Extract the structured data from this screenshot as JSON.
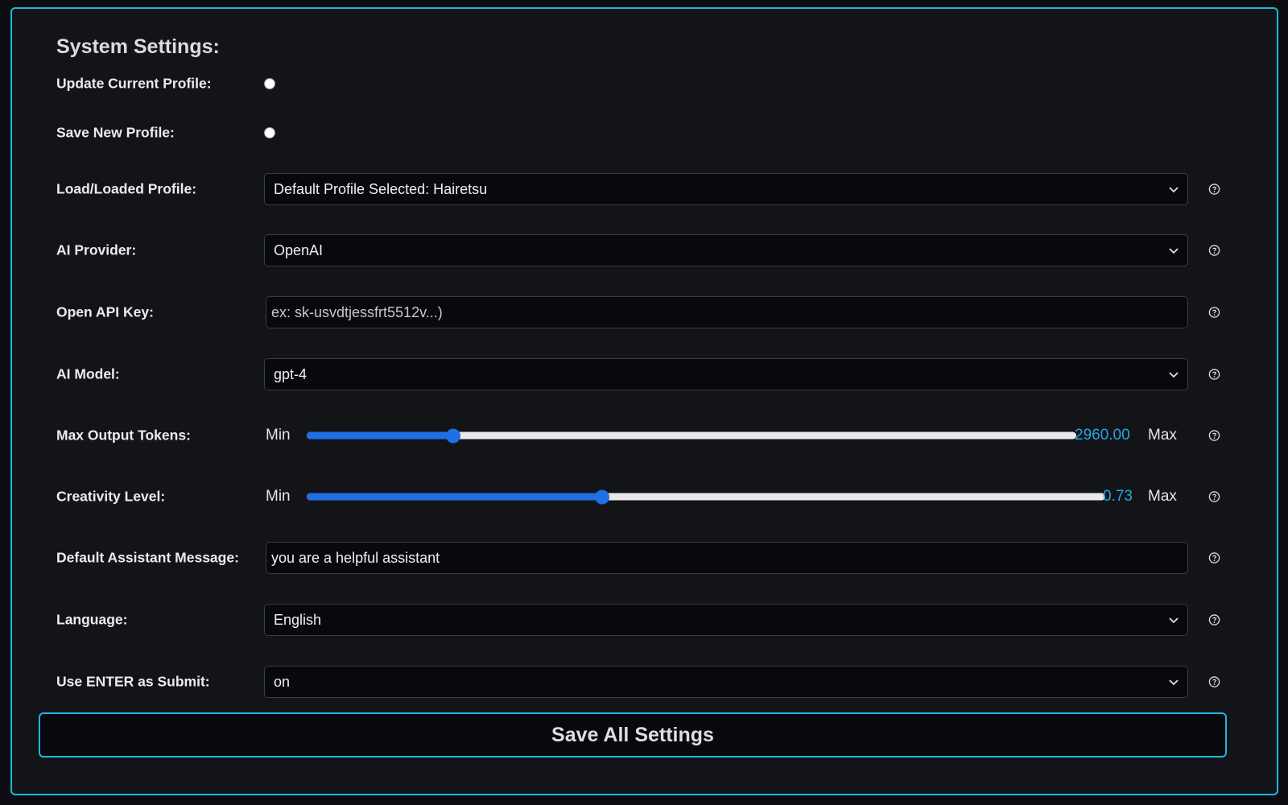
{
  "title": "System Settings:",
  "rows": {
    "update_profile": {
      "label": "Update Current Profile:"
    },
    "save_profile": {
      "label": "Save New Profile:"
    },
    "load_profile": {
      "label": "Load/Loaded Profile:",
      "value": "Default Profile Selected: Hairetsu"
    },
    "ai_provider": {
      "label": "AI Provider:",
      "value": "OpenAI"
    },
    "api_key": {
      "label": "Open API Key:",
      "placeholder": "ex: sk-usvdtjessfrt5512v...)",
      "value": ""
    },
    "ai_model": {
      "label": "AI Model:",
      "value": "gpt-4"
    },
    "max_tokens": {
      "label": "Max Output Tokens:",
      "min_label": "Min",
      "max_label": "Max",
      "value": "2960.00",
      "fraction": 0.19
    },
    "creativity": {
      "label": "Creativity Level:",
      "min_label": "Min",
      "max_label": "Max",
      "value": "0.73",
      "fraction": 0.37
    },
    "assistant_msg": {
      "label": "Default Assistant Message:",
      "value": "you are a helpful assistant"
    },
    "language": {
      "label": "Language:",
      "value": "English"
    },
    "enter_submit": {
      "label": "Use ENTER as Submit:",
      "value": "on"
    }
  },
  "save_button": {
    "label": "Save All Settings"
  },
  "colors": {
    "accent": "#1fb6e0",
    "slider": "#1f6fe5",
    "value_text": "#22a6e6",
    "background": "#131418"
  },
  "icons": {
    "help": "help-circle-icon",
    "dropdown": "chevron-down-icon"
  }
}
